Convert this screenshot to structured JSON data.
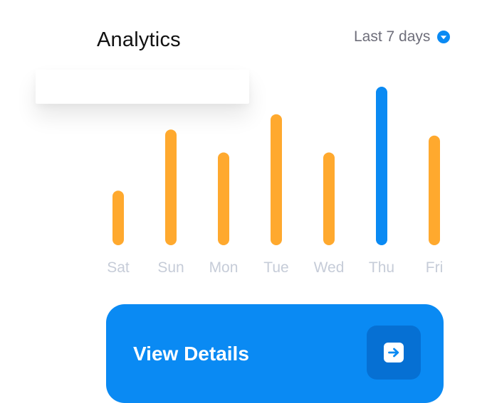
{
  "header": {
    "title": "Analytics",
    "range_label": "Last 7 days",
    "range_icon": "chevron-down-circle-icon"
  },
  "colors": {
    "bar_default": "#ffa92e",
    "bar_highlight": "#0a8af3",
    "axis_label": "#c6ccd8",
    "button_bg": "#0a8af3",
    "button_icon_bg": "#0670d3"
  },
  "chart_data": {
    "type": "bar",
    "title": "Analytics",
    "categories": [
      "Sat",
      "Sun",
      "Mon",
      "Tue",
      "Wed",
      "Thu",
      "Fri"
    ],
    "values": [
      32,
      72,
      57,
      82,
      57,
      100,
      68
    ],
    "highlight_index": 5,
    "ylim": [
      0,
      100
    ],
    "grid": false
  },
  "cta": {
    "label": "View Details",
    "icon": "arrow-right-square-icon"
  }
}
